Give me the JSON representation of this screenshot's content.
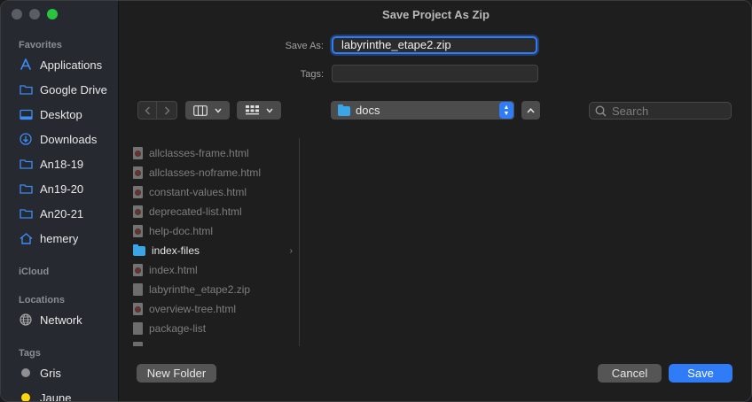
{
  "dialog": {
    "title": "Save Project As Zip"
  },
  "form": {
    "save_as_label": "Save As:",
    "save_as_value": "labyrinthe_etape2.zip",
    "tags_label": "Tags:",
    "tags_value": ""
  },
  "toolbar": {
    "location": "docs",
    "search_placeholder": "Search"
  },
  "sidebar": {
    "sections": {
      "favorites": "Favorites",
      "icloud": "iCloud",
      "locations": "Locations",
      "tags": "Tags"
    },
    "favorites": [
      {
        "label": "Applications",
        "icon": "applications-icon"
      },
      {
        "label": "Google Drive",
        "icon": "folder-icon"
      },
      {
        "label": "Desktop",
        "icon": "desktop-icon"
      },
      {
        "label": "Downloads",
        "icon": "downloads-icon"
      },
      {
        "label": "An18-19",
        "icon": "folder-icon"
      },
      {
        "label": "An19-20",
        "icon": "folder-icon"
      },
      {
        "label": "An20-21",
        "icon": "folder-icon"
      },
      {
        "label": "hemery",
        "icon": "home-icon"
      }
    ],
    "locations": [
      {
        "label": "Network",
        "icon": "network-icon"
      }
    ],
    "tags": [
      {
        "label": "Gris",
        "color": "#8e8e93"
      },
      {
        "label": "Jaune",
        "color": "#ffd60a"
      }
    ]
  },
  "files": [
    {
      "name": "allclasses-frame.html",
      "kind": "html"
    },
    {
      "name": "allclasses-noframe.html",
      "kind": "html"
    },
    {
      "name": "constant-values.html",
      "kind": "html"
    },
    {
      "name": "deprecated-list.html",
      "kind": "html"
    },
    {
      "name": "help-doc.html",
      "kind": "html"
    },
    {
      "name": "index-files",
      "kind": "folder"
    },
    {
      "name": "index.html",
      "kind": "html"
    },
    {
      "name": "labyrinthe_etape2.zip",
      "kind": "zip"
    },
    {
      "name": "overview-tree.html",
      "kind": "html"
    },
    {
      "name": "package-list",
      "kind": "plain"
    },
    {
      "name": "",
      "kind": "plain"
    }
  ],
  "buttons": {
    "new_folder": "New Folder",
    "cancel": "Cancel",
    "save": "Save"
  },
  "colors": {
    "accent": "#2f7cf6",
    "sidebar_icon": "#3b8cf5"
  }
}
